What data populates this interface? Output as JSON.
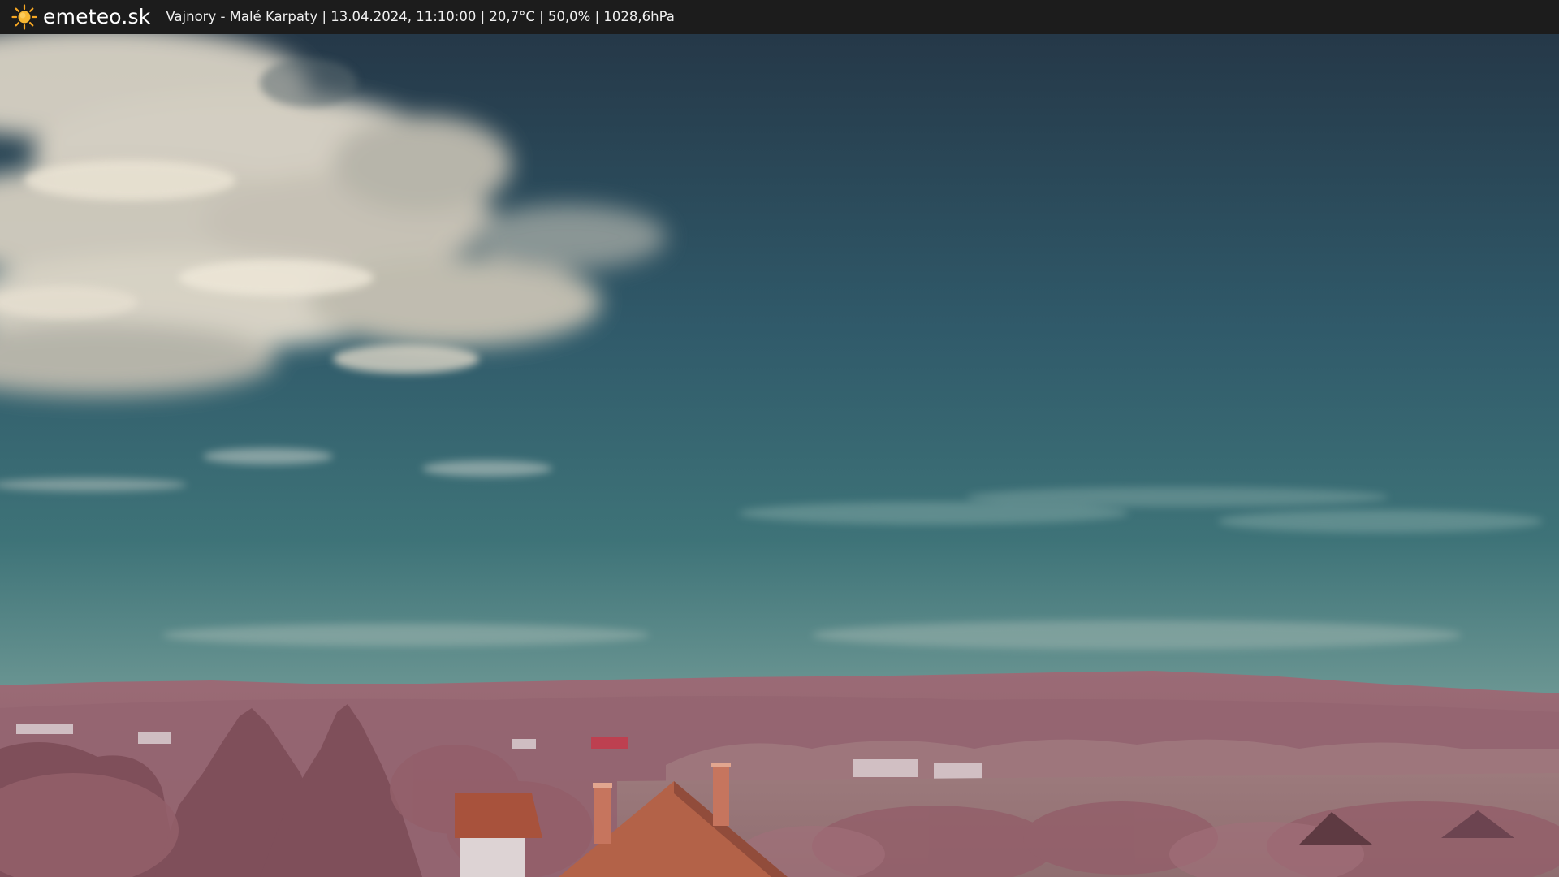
{
  "header": {
    "logo_icon": "sun-icon",
    "brand": "emeteo.sk",
    "info": "Vajnory - Malé Karpaty | 13.04.2024, 11:10:00 | 20,7°C | 50,0% | 1028,6hPa"
  },
  "webcam": {
    "image": "webcam-landscape-image",
    "colors": {
      "bar": "#1c1c1c",
      "sun": "#f5a623",
      "sky_top": "#253a4a",
      "sky_mid": "#3a6b78",
      "sky_horizon": "#6f9a98",
      "hills": "#9a6c78",
      "foliage": "#8a5a62",
      "roof": "#a8553c"
    }
  }
}
